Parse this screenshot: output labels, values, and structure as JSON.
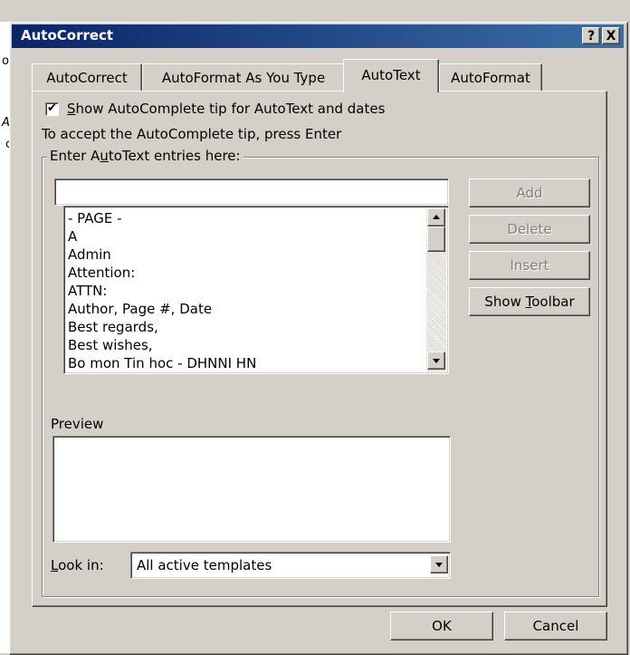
{
  "background_app": {
    "left_chars": [
      "o",
      "A",
      "c"
    ]
  },
  "dialog": {
    "title": "AutoCorrect",
    "help_label": "?",
    "close_label": "X",
    "tabs": [
      {
        "label": "AutoCorrect",
        "active": false
      },
      {
        "label": "AutoFormat As You Type",
        "active": false
      },
      {
        "label": "AutoText",
        "active": true
      },
      {
        "label": "AutoFormat",
        "active": false
      }
    ],
    "show_tip": {
      "checked": true,
      "check_glyph": "✔",
      "label_mnemonic": "S",
      "label_rest": "how AutoComplete tip for AutoText and dates"
    },
    "hint_text": "To accept the AutoComplete tip, press Enter",
    "entries_group": {
      "legend_pre": "Enter A",
      "legend_mnemonic": "u",
      "legend_post": "toText entries here:",
      "input_value": "",
      "items": [
        "- PAGE -",
        "A",
        "Admin",
        "Attention:",
        "ATTN:",
        "Author, Page #, Date",
        "Best regards,",
        "Best wishes,",
        "Bo mon Tin hoc - DHNNI HN"
      ]
    },
    "buttons": {
      "add": "Add",
      "delete": "Delete",
      "insert": "Insert",
      "show_toolbar_pre": "Show ",
      "show_toolbar_mnemonic": "T",
      "show_toolbar_post": "oolbar"
    },
    "preview_label": "Preview",
    "look_in": {
      "label_mnemonic": "L",
      "label_rest": "ook in:",
      "selected": "All active templates"
    },
    "footer": {
      "ok": "OK",
      "cancel": "Cancel"
    }
  }
}
